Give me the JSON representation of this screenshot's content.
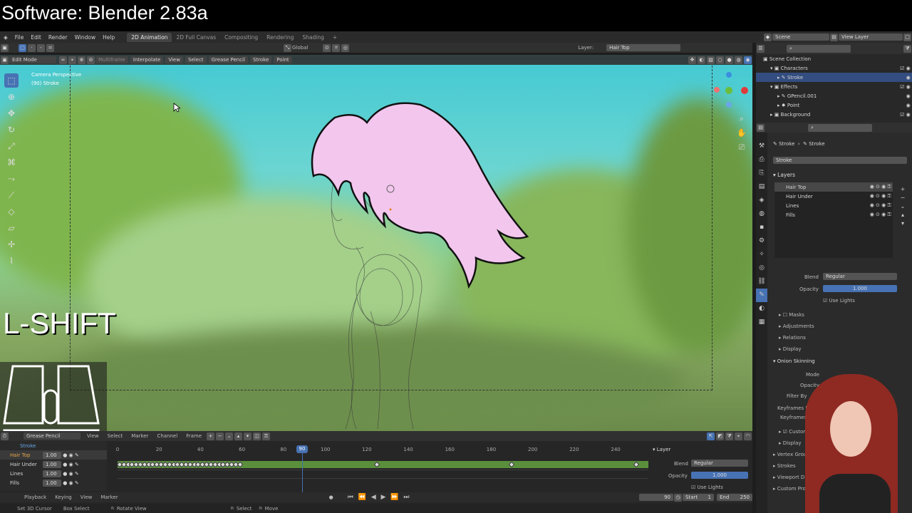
{
  "title_overlay": "Software: Blender 2.83a",
  "menu": [
    "File",
    "Edit",
    "Render",
    "Window",
    "Help"
  ],
  "workspaces": [
    "2D Animation",
    "2D Full Canvas",
    "Compositing",
    "Rendering",
    "Shading"
  ],
  "scene_label": "Scene",
  "view_layer_label": "View Layer",
  "header": {
    "orientation": "Global",
    "layer_label": "Layer:",
    "layer_value": "Hair Top"
  },
  "viewport_header": {
    "mode": "Edit Mode",
    "multiframe": "Multiframe",
    "interpolate": "Interpolate",
    "view": "View",
    "select": "Select",
    "grease_pencil": "Grease Pencil",
    "stroke": "Stroke",
    "point": "Point"
  },
  "viewport_info": {
    "line1": "Camera Perspective",
    "line2": "(90) Stroke"
  },
  "key_overlay": "L-SHIFT",
  "outliner": {
    "scene_collection": "Scene Collection",
    "characters": "Characters",
    "stroke": "Stroke",
    "effects": "Effects",
    "gpencil": "GPencil.001",
    "point": "Point",
    "background": "Background"
  },
  "properties": {
    "object": "Stroke",
    "data": "Stroke",
    "datablock": "Stroke",
    "layers_panel": "Layers",
    "layers": [
      "Hair Top",
      "Hair Under",
      "Lines",
      "Fills"
    ],
    "blend_label": "Blend",
    "blend_value": "Regular",
    "opacity_label": "Opacity",
    "opacity_value": "1.000",
    "use_lights": "Use Lights",
    "masks": "Masks",
    "adjustments": "Adjustments",
    "relations": "Relations",
    "display": "Display",
    "onion": "Onion Skinning",
    "mode_label": "Mode",
    "opacity2": "Opacity",
    "filter": "Filter By",
    "keyframes": "Keyframes B",
    "keyframes2": "Keyframes",
    "custom": "Custom",
    "display2": "Display",
    "vertex_groups": "Vertex Groups",
    "strokes": "Strokes",
    "viewport_display": "Viewport D",
    "custom_props": "Custom Pro"
  },
  "timeline": {
    "mode": "Grease Pencil",
    "view": "View",
    "select": "Select",
    "marker": "Marker",
    "channel": "Channel",
    "frame": "Frame",
    "ticks": [
      "0",
      "20",
      "40",
      "60",
      "80",
      "90",
      "100",
      "120",
      "140",
      "160",
      "180",
      "200",
      "220",
      "240"
    ],
    "current_frame": "90",
    "channels": [
      {
        "name": "Stroke",
        "val": ""
      },
      {
        "name": "Hair Top",
        "val": "1.00"
      },
      {
        "name": "Hair Under",
        "val": "1.00"
      },
      {
        "name": "Lines",
        "val": "1.00"
      },
      {
        "name": "Fills",
        "val": "1.00"
      }
    ],
    "layer_panel": "Layer",
    "blend_label": "Blend",
    "blend_value": "Regular",
    "opacity_label": "Opacity",
    "opacity_value": "1.000",
    "use_lights": "Use Lights",
    "playback": "Playback",
    "keying": "Keying",
    "view2": "View",
    "marker2": "Marker",
    "frame_value": "90",
    "start_label": "Start",
    "start_value": "1",
    "end_label": "End",
    "end_value": "250"
  },
  "statusbar": {
    "set_cursor": "Set 3D Cursor",
    "box_select": "Box Select",
    "rotate": "Rotate View",
    "select": "Select",
    "move": "Move"
  },
  "colors": {
    "accent": "#4772b3",
    "track": "#5a8f3c",
    "hair": "#f3c6ee",
    "current_frame": "#4772b3"
  }
}
